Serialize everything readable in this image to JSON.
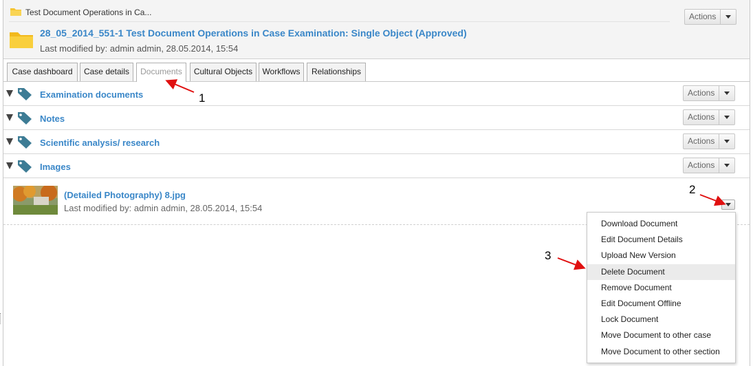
{
  "breadcrumb": {
    "text": "Test Document Operations in Ca..."
  },
  "case": {
    "title": "28_05_2014_551-1 Test Document Operations in Case Examination: Single Object (Approved)",
    "meta": "Last modified by: admin admin, 28.05.2014, 15:54",
    "actions_label": "Actions"
  },
  "tabs": [
    {
      "label": "Case dashboard"
    },
    {
      "label": "Case details"
    },
    {
      "label": "Documents"
    },
    {
      "label": "Cultural Objects"
    },
    {
      "label": "Workflows"
    },
    {
      "label": "Relationships"
    }
  ],
  "sections": [
    {
      "name": "Examination documents",
      "actions_label": "Actions"
    },
    {
      "name": "Notes",
      "actions_label": "Actions"
    },
    {
      "name": "Scientific analysis/ research",
      "actions_label": "Actions"
    },
    {
      "name": "Images",
      "actions_label": "Actions"
    }
  ],
  "document": {
    "name": "(Detailed Photography) 8.jpg",
    "meta": "Last modified by: admin admin, 28.05.2014, 15:54"
  },
  "menu": {
    "items": [
      {
        "label": "Download Document"
      },
      {
        "label": "Edit Document Details"
      },
      {
        "label": "Upload New Version"
      },
      {
        "label": "Delete Document"
      },
      {
        "label": "Remove Document"
      },
      {
        "label": "Edit Document Offline"
      },
      {
        "label": "Lock Document"
      },
      {
        "label": "Move Document to other case"
      },
      {
        "label": "Move Document to other section"
      }
    ]
  },
  "annotations": {
    "one": "1",
    "two": "2",
    "three": "3"
  },
  "colors": {
    "link": "#3a87c8",
    "folder": "#f5c431",
    "tag": "#3d7c95",
    "arrow": "#e01010"
  }
}
